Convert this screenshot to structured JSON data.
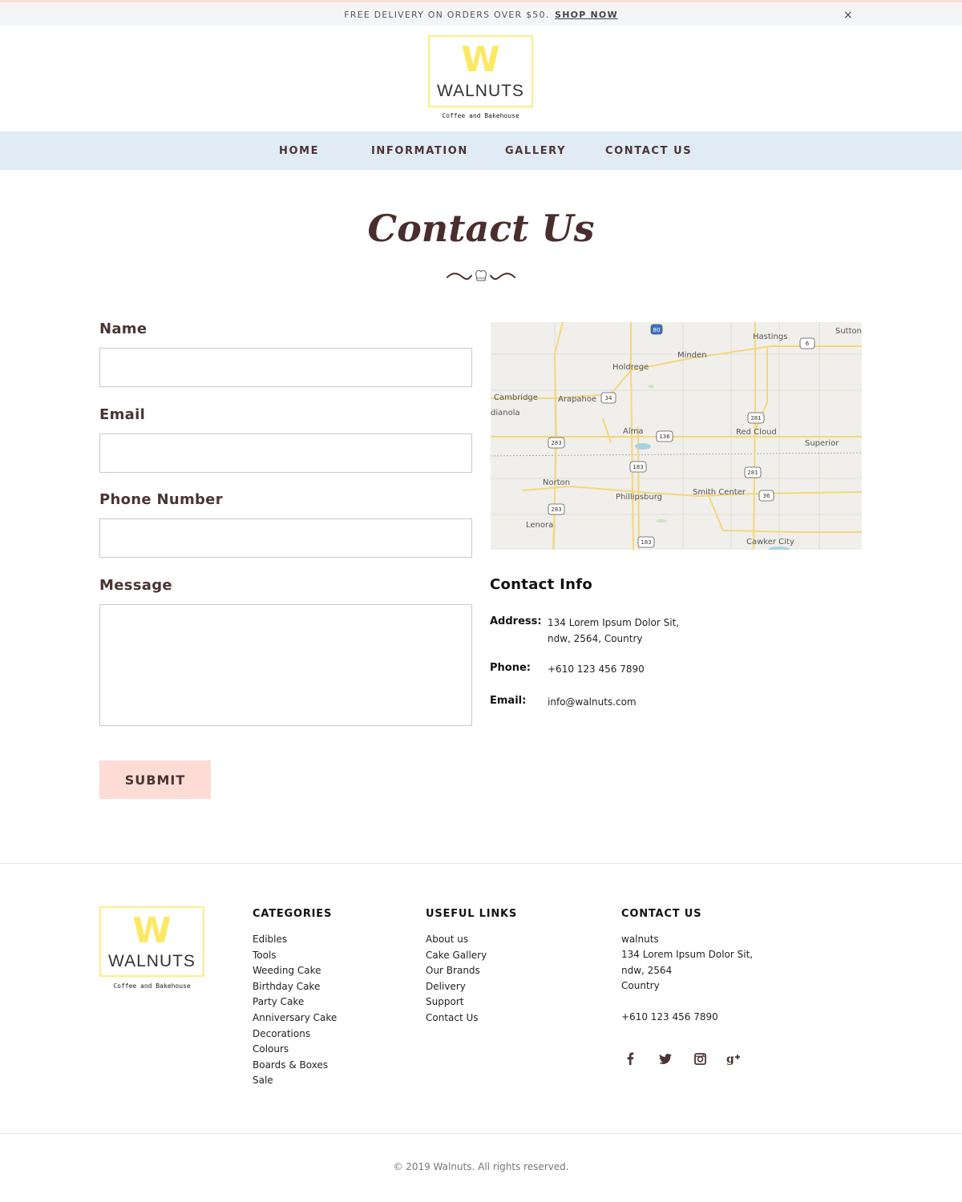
{
  "promo": {
    "text": "FREE DELIVERY ON ORDERS OVER $50.",
    "link": "SHOP NOW",
    "close": "×"
  },
  "brand": {
    "mark": "W",
    "name": "WALNUTS",
    "tagline": "Coffee and Bakehouse",
    "color": "#fbe964"
  },
  "nav": {
    "items": [
      "HOME",
      "INFORMATION",
      "GALLERY",
      "CONTACT US"
    ]
  },
  "page": {
    "title": "Contact Us"
  },
  "form": {
    "name_label": "Name",
    "email_label": "Email",
    "phone_label": "Phone Number",
    "message_label": "Message",
    "submit_label": "SUBMIT"
  },
  "map": {
    "places": [
      "Hastings",
      "Sutton",
      "Minden",
      "Holdrege",
      "Cambridge",
      "Arapahoe",
      "dianola",
      "Alma",
      "Red Cloud",
      "Superior",
      "Norton",
      "Phillipsburg",
      "Smith Center",
      "Lenora",
      "Cawker City"
    ],
    "shields": [
      "80",
      "6",
      "34",
      "281",
      "283",
      "136",
      "183",
      "281",
      "36",
      "283",
      "183"
    ]
  },
  "contact_info": {
    "title": "Contact Info",
    "address_label": "Address:",
    "address_line1": "134 Lorem Ipsum Dolor Sit,",
    "address_line2": "ndw, 2564, Country",
    "phone_label": "Phone:",
    "phone": "+610 123 456 7890",
    "email_label": "Email:",
    "email": "info@walnuts.com"
  },
  "footer": {
    "categories": {
      "title": "CATEGORIES",
      "items": [
        "Edibles",
        "Tools",
        "Weeding Cake",
        "Birthday Cake",
        "Party Cake",
        "Anniversary Cake",
        "Decorations",
        "Colours",
        "Boards & Boxes",
        "Sale"
      ]
    },
    "useful_links": {
      "title": "USEFUL LINKS",
      "items": [
        "About us",
        "Cake Gallery",
        "Our Brands",
        "Delivery",
        "Support",
        "Contact Us"
      ]
    },
    "contact": {
      "title": "CONTACT US",
      "name": "walnuts",
      "line1": "134 Lorem Ipsum Dolor Sit,",
      "line2": "ndw, 2564",
      "line3": "Country",
      "phone": "+610 123 456 7890"
    },
    "social": [
      "facebook-icon",
      "twitter-icon",
      "instagram-icon",
      "google-plus-icon"
    ],
    "copyright": "© 2019  Walnuts. All rights reserved."
  },
  "colors": {
    "accent_pink": "#fcdcd5",
    "nav_blue": "#e1ebf5",
    "brown": "#4a3434",
    "logo_yellow": "#fbe964"
  }
}
